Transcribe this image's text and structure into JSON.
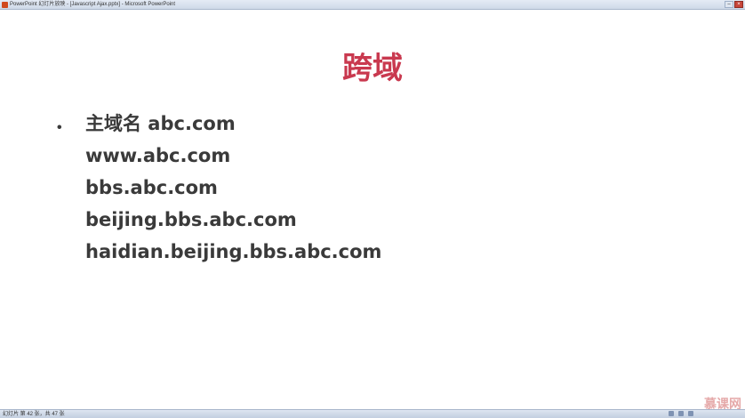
{
  "window": {
    "title": "PowerPoint 幻灯片放映 - [Javascript Ajax.pptx] - Microsoft PowerPoint",
    "minimize_glyph": "–",
    "close_glyph": "×"
  },
  "slide": {
    "title": "跨域",
    "bullet_glyph": "•",
    "items": [
      "主域名 abc.com",
      "www.abc.com",
      "bbs.abc.com",
      "beijing.bbs.abc.com",
      "haidian.beijing.bbs.abc.com"
    ]
  },
  "status": {
    "slide_info": "幻灯片 第 42 张，共 47 张"
  },
  "watermark": {
    "text": "慕课网"
  },
  "colors": {
    "title": "#c9394f",
    "body_text": "#3a3a3a"
  }
}
